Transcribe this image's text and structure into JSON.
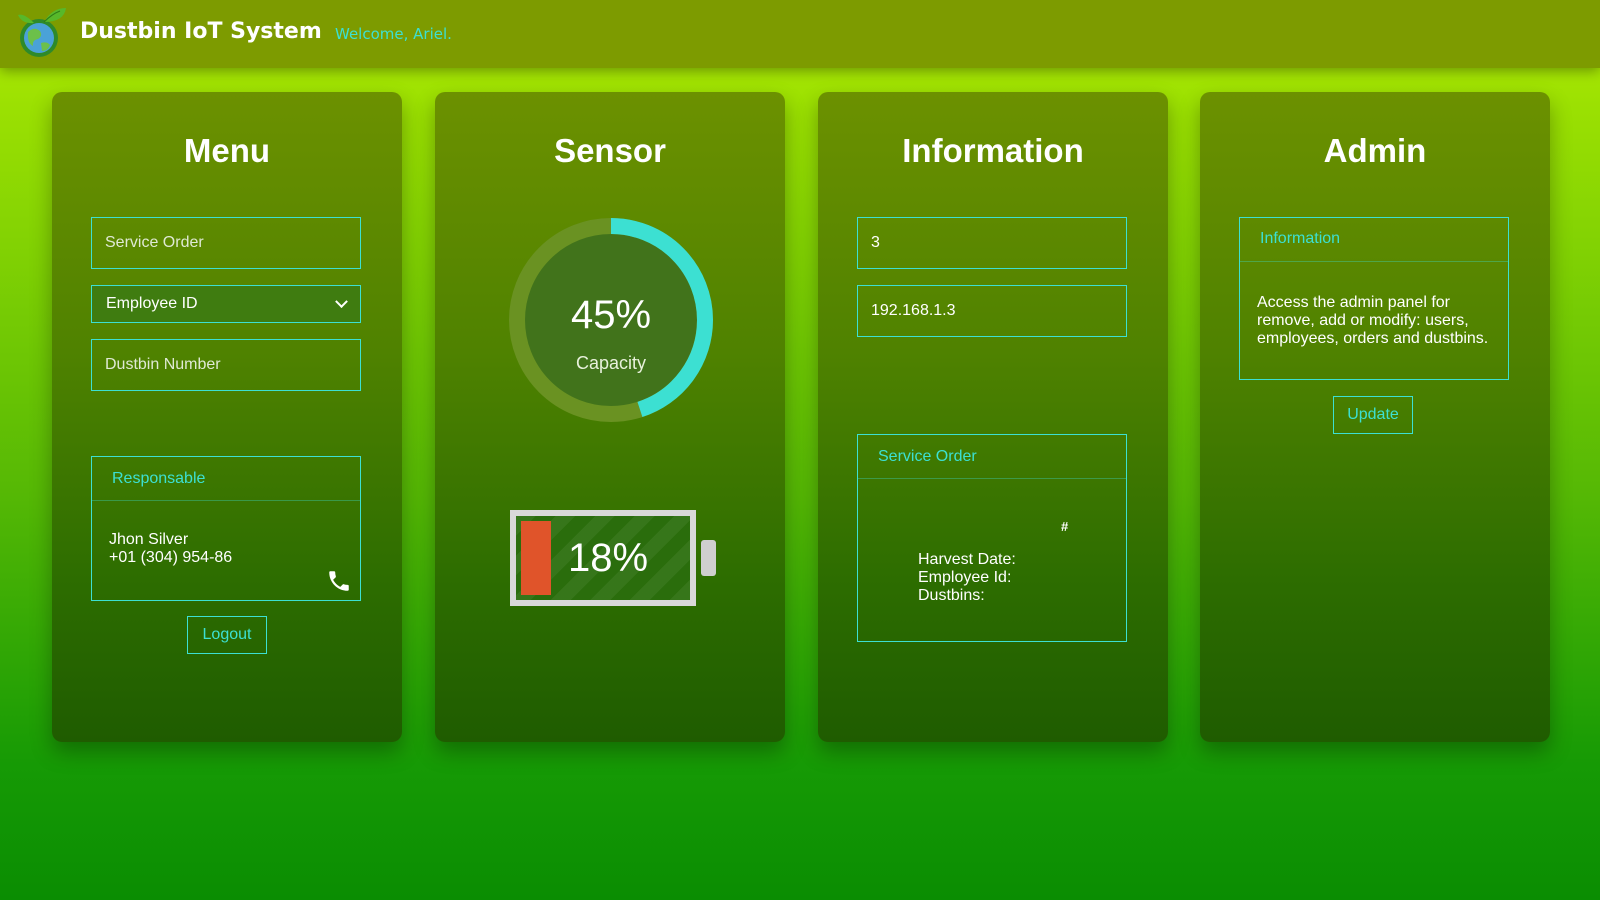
{
  "header": {
    "title": "Dustbin IoT System",
    "welcome": "Welcome, Ariel."
  },
  "menu": {
    "title": "Menu",
    "service_order_placeholder": "Service Order",
    "employee_select_value": "Employee ID",
    "dustbin_number_placeholder": "Dustbin Number",
    "responsable": {
      "heading": "Responsable",
      "name": "Jhon Silver",
      "phone": "+01 (304) 954-86"
    },
    "logout_label": "Logout"
  },
  "sensor": {
    "title": "Sensor",
    "capacity_percent": 45,
    "capacity_value": "45%",
    "capacity_label": "Capacity",
    "battery_percent": 18,
    "battery_value": "18%"
  },
  "information": {
    "title": "Information",
    "id_value": "3",
    "ip_value": "192.168.1.3",
    "service_order": {
      "heading": "Service Order",
      "number_mark": "#",
      "harvest_date_label": "Harvest Date:",
      "employee_id_label": "Employee Id:",
      "dustbins_label": "Dustbins:"
    }
  },
  "admin": {
    "title": "Admin",
    "info_heading": "Information",
    "info_text": "Access the admin panel for remove, add or modify: users, employees, orders and dustbins.",
    "update_label": "Update"
  },
  "colors": {
    "accent": "#3ce0d2",
    "header_bg": "#7d9b00",
    "battery_fill": "#e0542a"
  },
  "icons": {
    "logo": "globe-leaf-logo",
    "phone": "phone-icon",
    "select": "chevron-down-icon"
  }
}
